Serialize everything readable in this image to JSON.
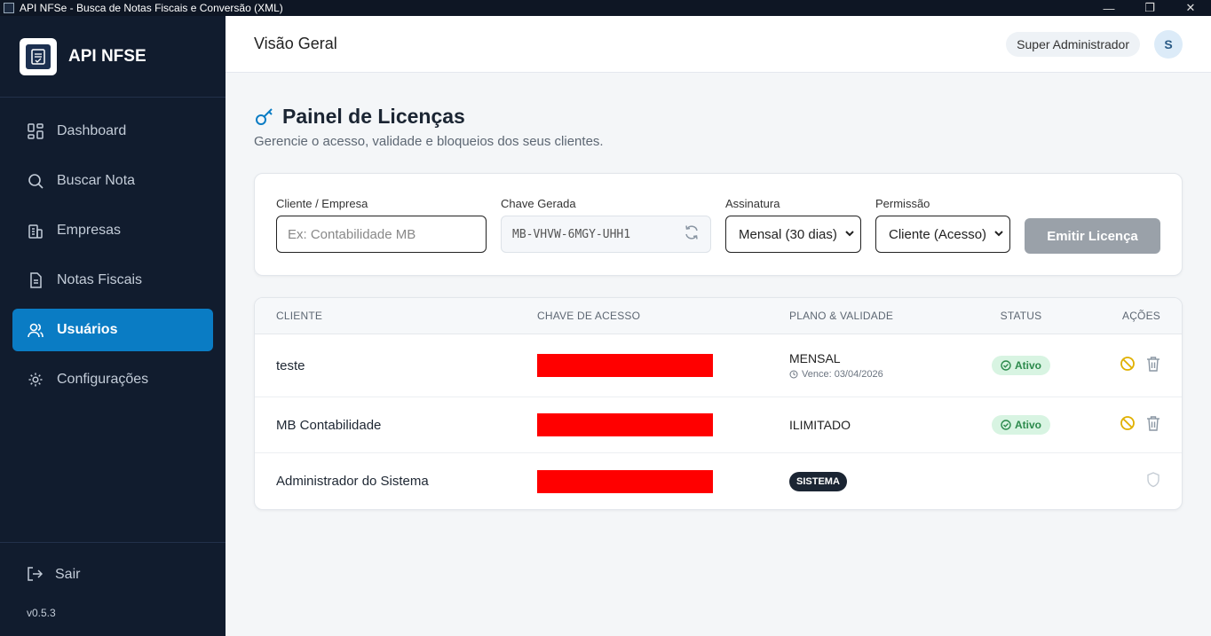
{
  "window": {
    "title": "API NFSe - Busca de Notas Fiscais e Conversão (XML)"
  },
  "brand": {
    "name": "API NFSE"
  },
  "sidebar": {
    "items": [
      {
        "label": "Dashboard",
        "icon": "dashboard-icon"
      },
      {
        "label": "Buscar Nota",
        "icon": "search-icon"
      },
      {
        "label": "Empresas",
        "icon": "building-icon"
      },
      {
        "label": "Notas Fiscais",
        "icon": "document-icon"
      },
      {
        "label": "Usuários",
        "icon": "users-icon",
        "active": true
      },
      {
        "label": "Configurações",
        "icon": "gear-icon"
      }
    ],
    "logout": "Sair",
    "version": "v0.5.3"
  },
  "header": {
    "page_title": "Visão Geral",
    "role": "Super Administrador",
    "avatar_initial": "S"
  },
  "panel": {
    "title": "Painel de Licenças",
    "subtitle": "Gerencie o acesso, validade e bloqueios dos seus clientes."
  },
  "form": {
    "client_label": "Cliente / Empresa",
    "client_placeholder": "Ex: Contabilidade MB",
    "key_label": "Chave Gerada",
    "key_value": "MB-VHVW-6MGY-UHH1",
    "plan_label": "Assinatura",
    "plan_value": "Mensal (30 dias)",
    "perm_label": "Permissão",
    "perm_value": "Cliente (Acesso)",
    "emit_button": "Emitir Licença"
  },
  "table": {
    "headers": [
      "CLIENTE",
      "CHAVE DE ACESSO",
      "PLANO & VALIDADE",
      "STATUS",
      "AÇÕES"
    ],
    "rows": [
      {
        "client": "teste",
        "plan": "MENSAL",
        "expires": "Vence: 03/04/2026",
        "status": "Ativo"
      },
      {
        "client": "MB Contabilidade",
        "plan": "ILIMITADO",
        "status": "Ativo"
      },
      {
        "client": "Administrador do Sistema",
        "plan": "SISTEMA"
      }
    ]
  },
  "colors": {
    "sidebar_bg": "#111c2e",
    "accent": "#0a7cc4",
    "redaction": "#ff0000",
    "success": "#2c8a4c",
    "warning": "#e0b000"
  }
}
